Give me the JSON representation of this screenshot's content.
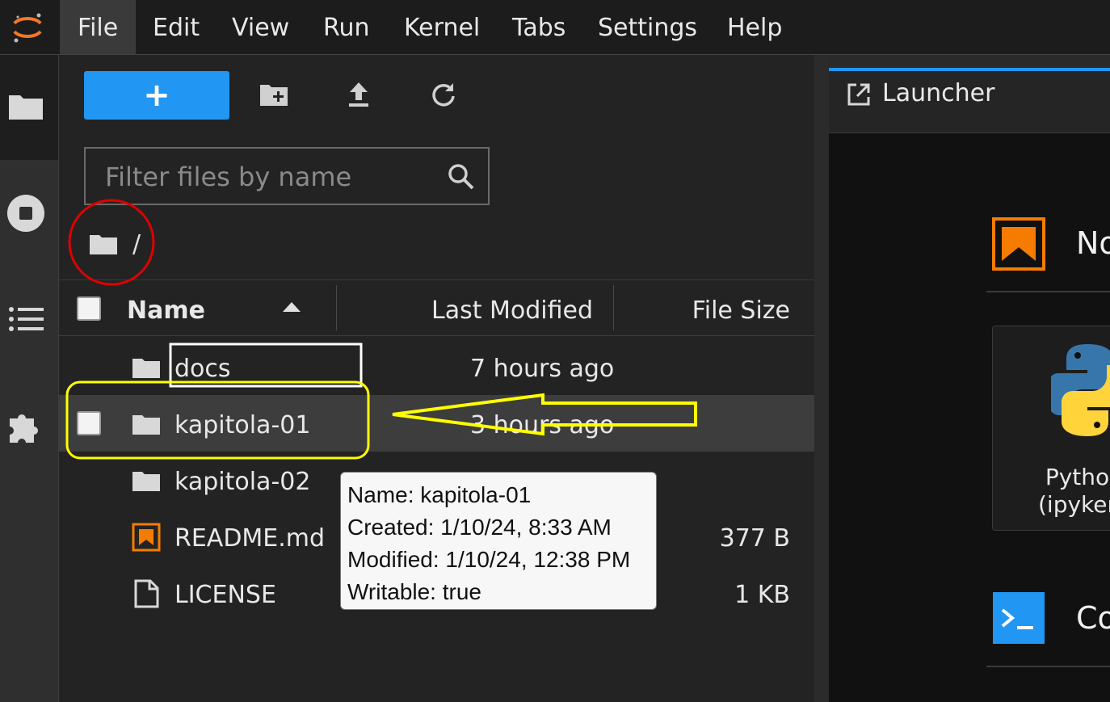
{
  "menubar": {
    "items": [
      {
        "label": "File"
      },
      {
        "label": "Edit"
      },
      {
        "label": "View"
      },
      {
        "label": "Run"
      },
      {
        "label": "Kernel"
      },
      {
        "label": "Tabs"
      },
      {
        "label": "Settings"
      },
      {
        "label": "Help"
      }
    ],
    "active_item": "File"
  },
  "activity_bar": {
    "icons": [
      "folder-icon",
      "stop-circle-icon",
      "list-icon",
      "puzzle-icon"
    ]
  },
  "file_browser": {
    "new_button_symbol": "+",
    "filter": {
      "placeholder": "Filter files by name",
      "value": ""
    },
    "breadcrumb": {
      "root": "/"
    },
    "columns": {
      "name": "Name",
      "last_modified": "Last Modified",
      "file_size": "File Size"
    },
    "rows": [
      {
        "name": "docs",
        "modified": "7 hours ago",
        "size": "",
        "type": "folder"
      },
      {
        "name": "kapitola-01",
        "modified": "3 hours ago",
        "size": "",
        "type": "folder",
        "selected": true
      },
      {
        "name": "kapitola-02",
        "modified": "",
        "size": "",
        "type": "folder"
      },
      {
        "name": "README.md",
        "modified": "",
        "size": "377 B",
        "type": "markdown"
      },
      {
        "name": "LICENSE",
        "modified": "",
        "size": "1 KB",
        "type": "file"
      }
    ]
  },
  "tooltip": {
    "name": "Name: kapitola-01",
    "created": "Created: 1/10/24, 8:33 AM",
    "modified": "Modified: 1/10/24, 12:38 PM",
    "writable": "Writable: true"
  },
  "main_area": {
    "tab_title": "Launcher",
    "sections": [
      {
        "title": "No"
      },
      {
        "title": "Co"
      }
    ],
    "kernel_card_label": "Pytho\n(ipyker"
  },
  "colors": {
    "accent": "#2196f3",
    "annotation_red": "#e00000",
    "annotation_yellow": "#ffff00",
    "markdown_orange": "#f57c00"
  }
}
